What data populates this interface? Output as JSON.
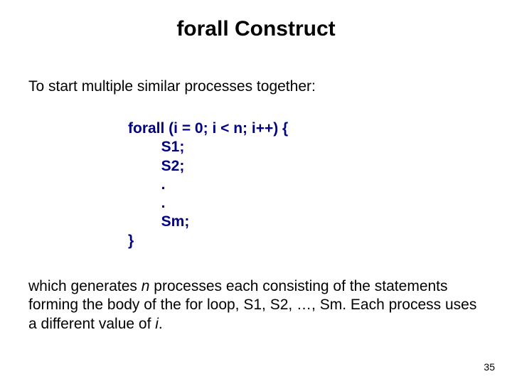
{
  "title": "forall Construct",
  "intro": "To start multiple similar processes together:",
  "code": {
    "l1": "forall (i = 0; i < n; i++) {",
    "l2": "        S1;",
    "l3": "        S2;",
    "l4": "        .",
    "l5": "        .",
    "l6": "        Sm;",
    "l7": "}"
  },
  "desc": {
    "p1": "which generates ",
    "n": "n",
    "p2": " processes each consisting of the statements forming the body of the for loop, S1, S2, …, Sm. Each process uses a different value of ",
    "i": "i",
    "p3": "."
  },
  "page_number": "35"
}
